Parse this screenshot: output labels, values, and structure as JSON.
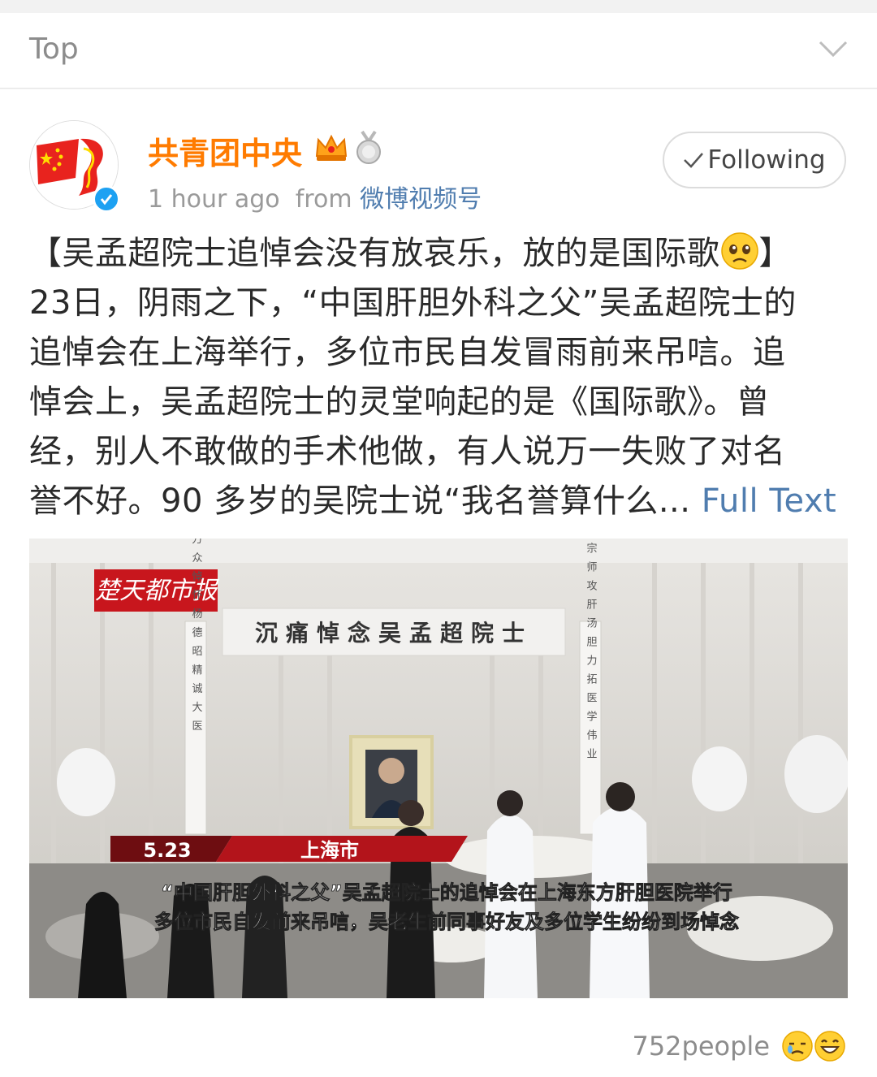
{
  "top_bar": {
    "label": "Top",
    "icon": "chevron-down-icon"
  },
  "post": {
    "author": "共青团中央",
    "time": "1 hour ago",
    "from_label": "from",
    "source": "微博视频号",
    "follow_label": "Following",
    "text_lines": [
      "【吴孟超院士追悼会没有放哀乐，放的是国际歌",
      "23日，阴雨之下，“中国肝胆外科之父”吴孟超院士的",
      "追悼会在上海举行，多位市民自发冒雨前来吊唁。追",
      "悼会上，吴孟超院士的灵堂响起的是《国际歌》。曾",
      "经，别人不敢做的手术他做，有人说万一失败了对名",
      "誉不好。90 多岁的吴院士说“我名誉算什么... "
    ],
    "title_close": "】",
    "full_text_label": "Full Text",
    "media": {
      "logo_text": "楚天都市报",
      "banner": "沉痛悼念吴孟超院士",
      "left_scroll": "万众悼怀杨德昭精诚大医",
      "right_scroll": "一代宗师攻肝汤胆力拓医学伟业",
      "date": "5.23",
      "location": "上海市",
      "caption_line1": "“中国肝胆外科之父”吴孟超院士的追悼会在上海东方肝胆医院举行",
      "caption_line2": "多位市民自发前来吊唁，吴老生前同事好友及多位学生纷纷到场悼念"
    },
    "reactions": {
      "count": "752people"
    }
  }
}
